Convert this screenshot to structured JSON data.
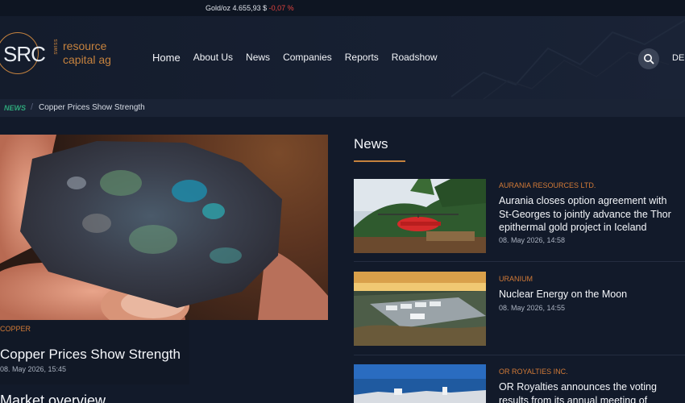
{
  "ticker": {
    "label": "Gold/oz",
    "value": "4.655,93 $",
    "change": "-0,07 %"
  },
  "logo": {
    "mark": "SRC",
    "vertical": "swiss",
    "line1": "resource",
    "line2": "capital ag"
  },
  "nav": {
    "items": [
      "Home",
      "About Us",
      "News",
      "Companies",
      "Reports",
      "Roadshow"
    ]
  },
  "header": {
    "lang": "DE"
  },
  "breadcrumb": {
    "section": "NEWS",
    "separator": "/",
    "page": "Copper Prices Show Strength"
  },
  "hero": {
    "category": "COPPER",
    "title": "Copper Prices Show Strength",
    "date": "08. May 2026, 15:45"
  },
  "section_market": {
    "title": "Market overview"
  },
  "news": {
    "title": "News",
    "items": [
      {
        "category": "AURANIA RESOURCES LTD.",
        "title": "Aurania closes option agreement with St-Georges to jointly advance the Thor epithermal gold project in Iceland",
        "date": "08. May 2026, 14:58"
      },
      {
        "category": "URANIUM",
        "title": "Nuclear Energy on the Moon",
        "date": "08. May 2026, 14:55"
      },
      {
        "category": "OR ROYALTIES INC.",
        "title": "OR Royalties announces the voting results from its annual meeting of",
        "date": ""
      }
    ]
  },
  "colors": {
    "accent": "#c5823e",
    "category": "#d27a37",
    "negative": "#e0433e",
    "news_tag": "#2ea77a"
  }
}
